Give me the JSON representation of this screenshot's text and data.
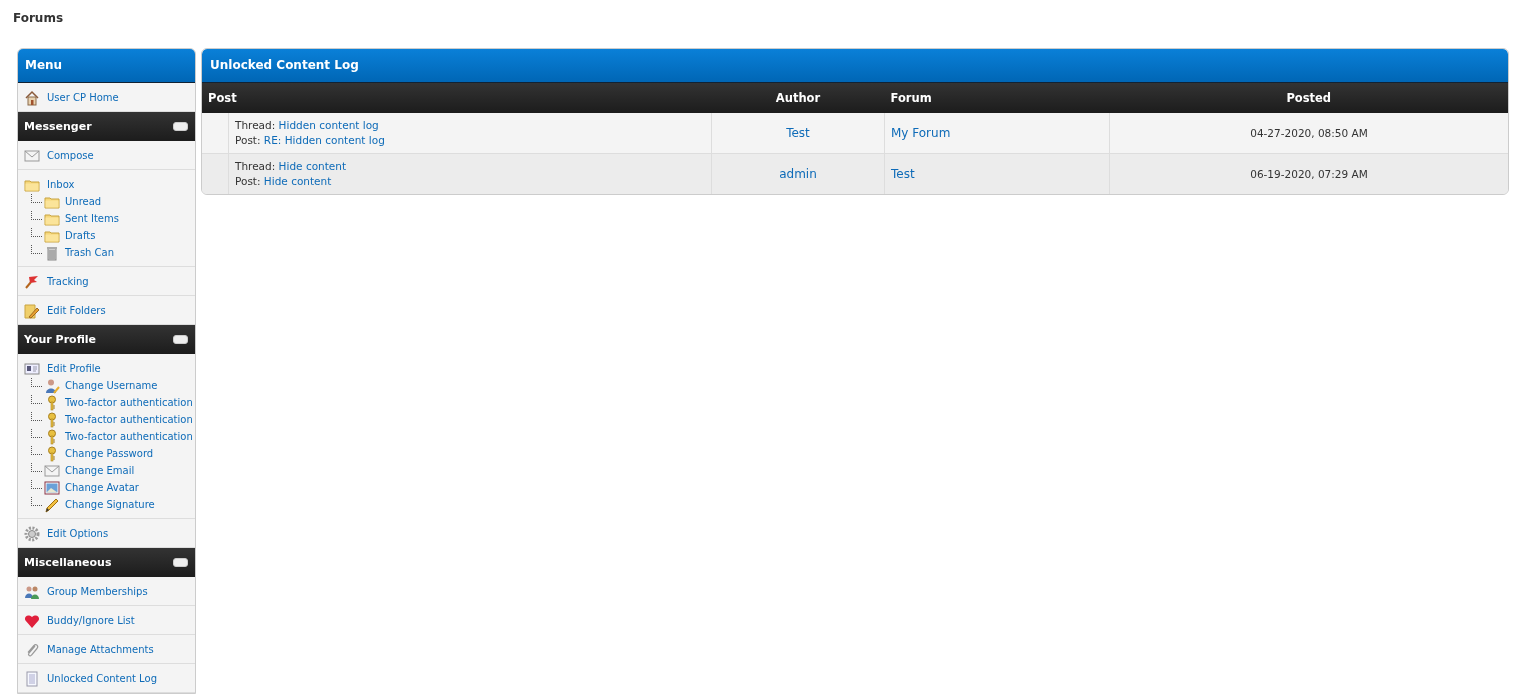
{
  "page_title": "Forums",
  "sidebar": {
    "title": "Menu",
    "sections": [
      {
        "items": [
          {
            "label": "User CP Home",
            "kind": "home"
          }
        ]
      },
      {
        "heading": "Messenger",
        "expanded": true,
        "items": [
          {
            "label": "Compose",
            "kind": "mail"
          },
          {
            "label": "Inbox",
            "kind": "folder",
            "children": [
              {
                "label": "Unread",
                "kind": "folder"
              },
              {
                "label": "Sent Items",
                "kind": "folder"
              },
              {
                "label": "Drafts",
                "kind": "folder"
              },
              {
                "label": "Trash Can",
                "kind": "trash"
              }
            ]
          },
          {
            "label": "Tracking",
            "kind": "flag"
          },
          {
            "label": "Edit Folders",
            "kind": "folderedit"
          }
        ]
      },
      {
        "heading": "Your Profile",
        "expanded": true,
        "items": [
          {
            "label": "Edit Profile",
            "kind": "card",
            "children": [
              {
                "label": "Change Username",
                "kind": "user"
              },
              {
                "label": "Two-factor authentication",
                "kind": "key"
              },
              {
                "label": "Two-factor authentication",
                "kind": "key"
              },
              {
                "label": "Two-factor authentication",
                "kind": "key"
              },
              {
                "label": "Change Password",
                "kind": "key"
              },
              {
                "label": "Change Email",
                "kind": "mail"
              },
              {
                "label": "Change Avatar",
                "kind": "picture"
              },
              {
                "label": "Change Signature",
                "kind": "pencil"
              }
            ]
          },
          {
            "label": "Edit Options",
            "kind": "gear"
          }
        ]
      },
      {
        "heading": "Miscellaneous",
        "expanded": true,
        "items": [
          {
            "label": "Group Memberships",
            "kind": "group"
          },
          {
            "label": "Buddy/Ignore List",
            "kind": "heart"
          },
          {
            "label": "Manage Attachments",
            "kind": "clip"
          },
          {
            "label": "Unlocked Content Log",
            "kind": "page"
          }
        ]
      }
    ]
  },
  "log": {
    "title": "Unlocked Content Log",
    "columns": [
      "Post",
      "Author",
      "Forum",
      "Posted"
    ],
    "rows": [
      {
        "thread_label": "Thread:",
        "thread": "Hidden content log",
        "post_label": "Post:",
        "post": "RE: Hidden content log",
        "author": "Test",
        "forum": "My Forum",
        "posted": "04-27-2020, 08:50 AM"
      },
      {
        "thread_label": "Thread:",
        "thread": "Hide content",
        "post_label": "Post:",
        "post": "Hide content",
        "author": "admin",
        "forum": "Test",
        "posted": "06-19-2020, 07:29 AM"
      }
    ]
  }
}
